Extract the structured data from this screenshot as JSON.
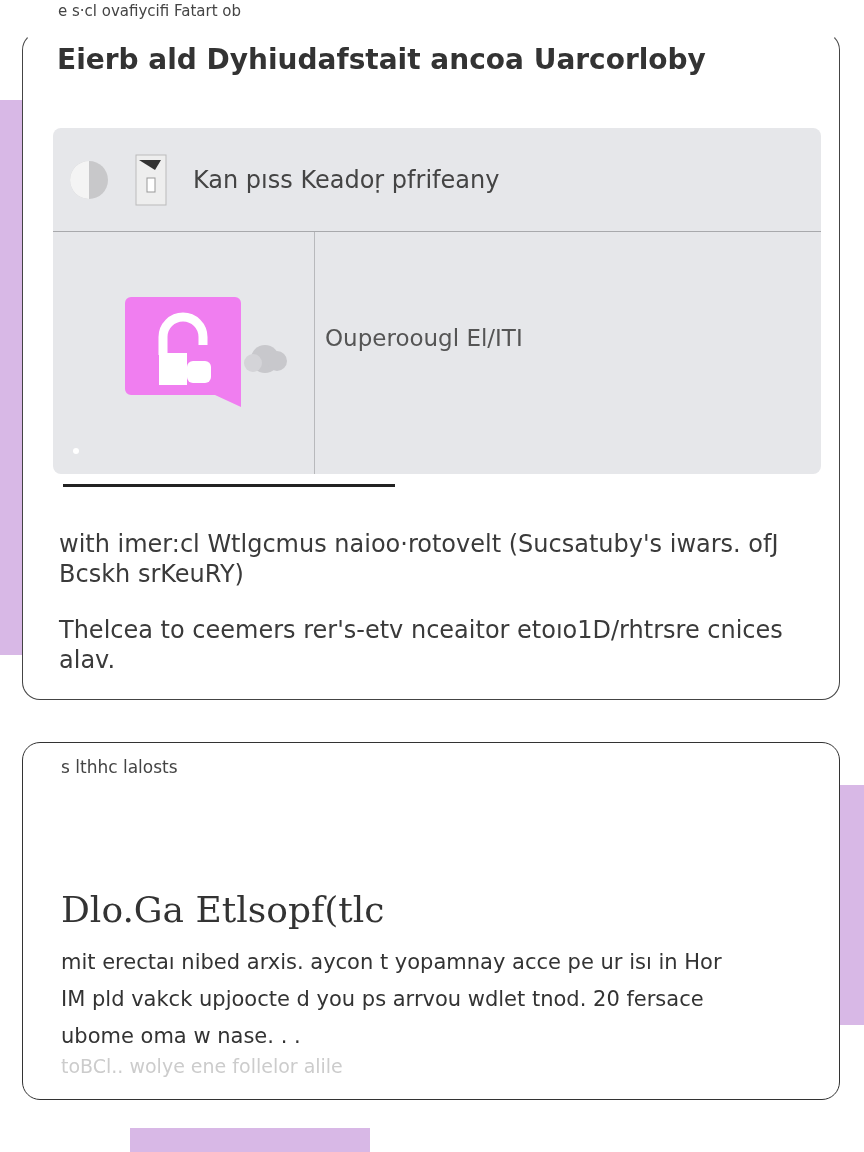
{
  "caption": "e s·cl ovafiycifi Fatart ob",
  "card": {
    "title": "Eierb ald Dyhiudafstait ancoa Uarcorloby",
    "panel": {
      "header": "Kan pıss Keadoṛ pfrifeany",
      "label": "Ouperoougl El/ITI"
    },
    "paragraphs": [
      "with imer:cl Wtlgcmus naioo·rotovelt (Sucsatuby's iwars. ofJ Bcskh srKeuRY)",
      "Thelcea to ceemers rer's-etv nceaitor etoıo1D/rhtrsre cnices alav."
    ]
  },
  "card2": {
    "eyebrow": "s lthhc lalosts",
    "title": "Dlo.Ga Etlsopf(tlc",
    "body": "mit erectaı nibed arxis. aycon t yopamnay acce pe ur isı in Hor IM pld vakck upjoocte d you ps arrvou wdlet tnod. 20 fersace ubome oma w nase. . .",
    "faded": "toBCl.. wolye ene follelor alile"
  }
}
